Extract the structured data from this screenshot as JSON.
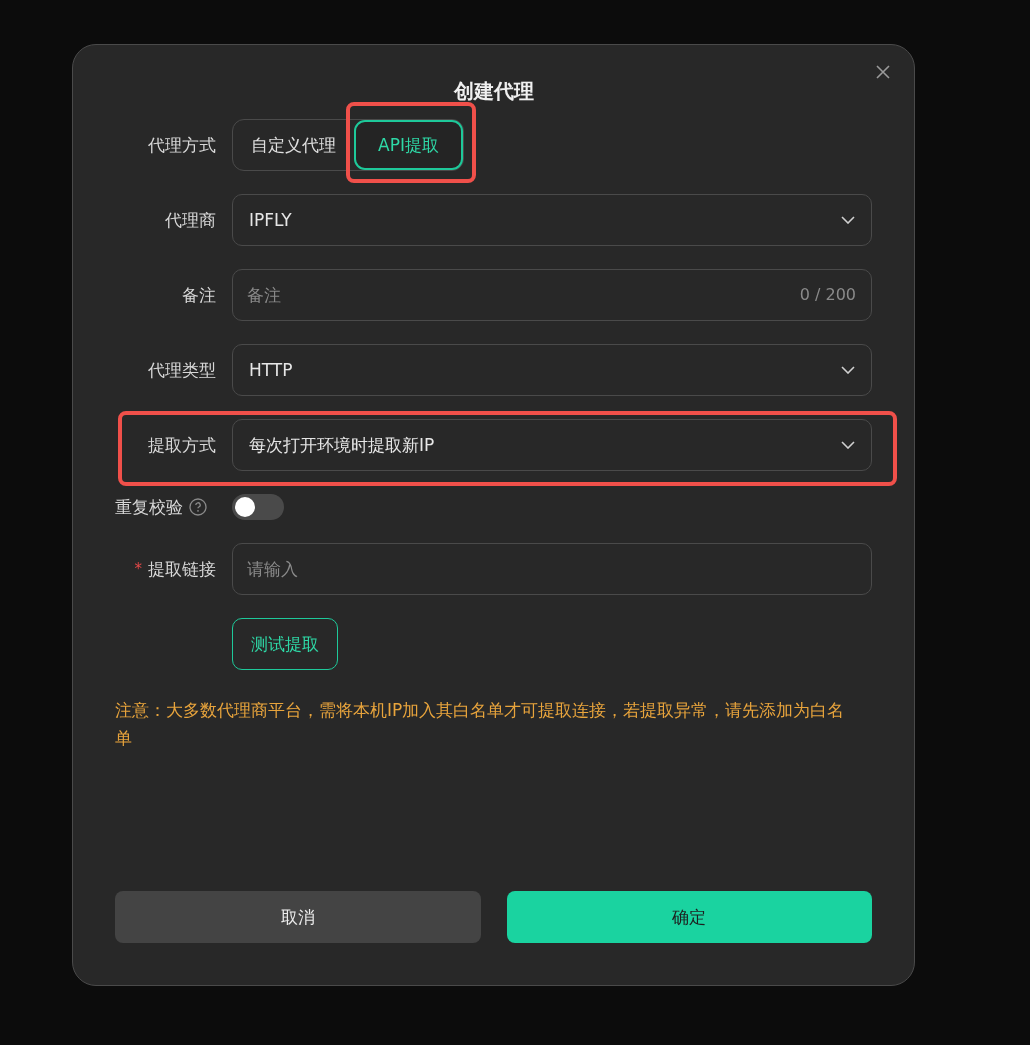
{
  "dialog": {
    "title": "创建代理",
    "fields": [
      {
        "kind": "segmented",
        "label": "代理方式",
        "options": [
          {
            "label": "自定义代理",
            "selected": false,
            "highlighted": false
          },
          {
            "label": "API提取",
            "selected": true,
            "highlighted": true
          }
        ]
      },
      {
        "kind": "select",
        "label": "代理商",
        "value": "IPFLY"
      },
      {
        "kind": "input",
        "label": "备注",
        "placeholder": "备注",
        "counter": "0 / 200"
      },
      {
        "kind": "select",
        "label": "代理类型",
        "value": "HTTP"
      },
      {
        "kind": "select",
        "label": "提取方式",
        "value": "每次打开环境时提取新IP",
        "highlighted": true
      },
      {
        "kind": "switch",
        "label": "重复校验",
        "help": true,
        "on": false
      },
      {
        "kind": "input",
        "label": "提取链接",
        "required_mark": "*",
        "placeholder": "请输入"
      },
      {
        "kind": "button",
        "label": "测试提取"
      }
    ],
    "note": "注意：大多数代理商平台，需将本机IP加入其白名单才可提取连接，若提取异常，请先添加为白名单",
    "buttons": [
      {
        "label": "取消",
        "kind": "secondary"
      },
      {
        "label": "确定",
        "kind": "primary"
      }
    ]
  }
}
